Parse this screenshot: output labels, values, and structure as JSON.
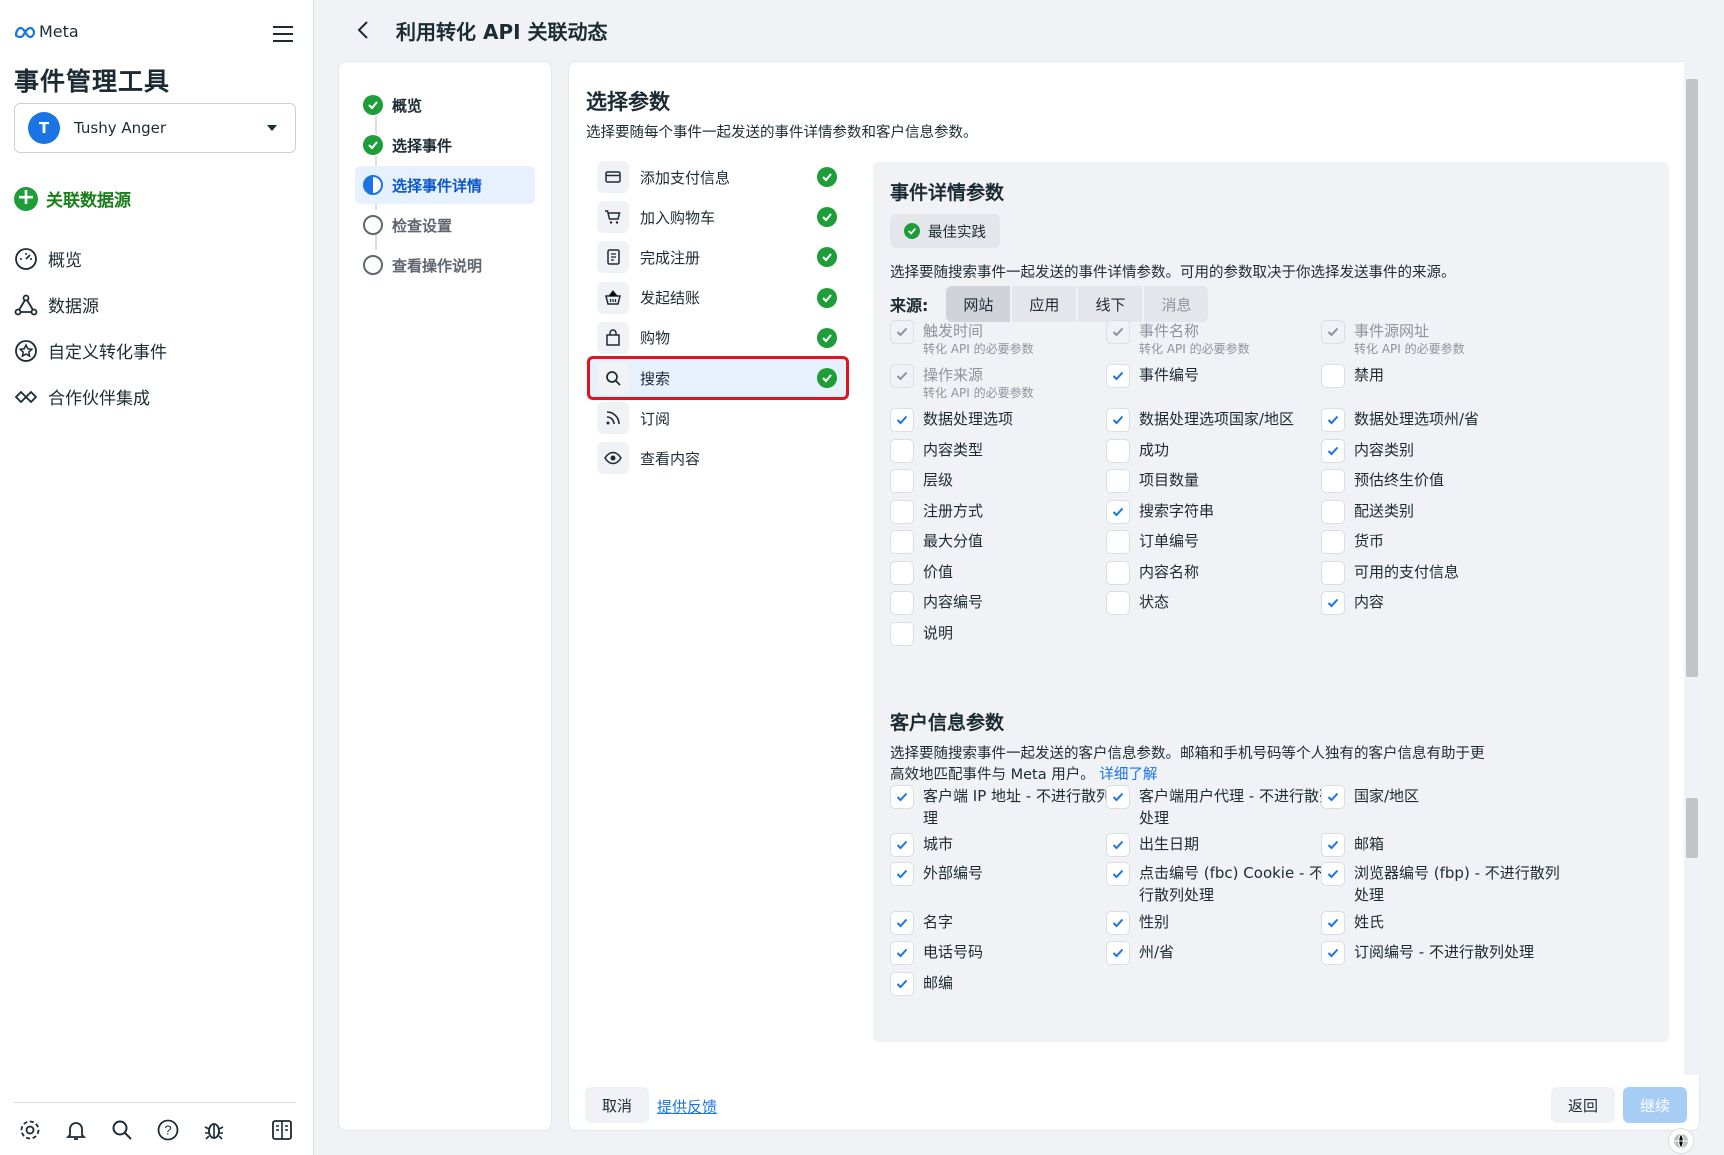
{
  "sidebar": {
    "brand": "Meta",
    "app_title": "事件管理工具",
    "account": {
      "initial": "T",
      "name": "Tushy Anger"
    },
    "connect_label": "关联数据源",
    "nav": [
      {
        "label": "概览",
        "icon": "dashboard-icon"
      },
      {
        "label": "数据源",
        "icon": "datasource-icon"
      },
      {
        "label": "自定义转化事件",
        "icon": "star-badge-icon"
      },
      {
        "label": "合作伙伴集成",
        "icon": "handshake-icon"
      }
    ],
    "bottom_icons": [
      "settings-icon",
      "bell-icon",
      "search-icon",
      "help-icon",
      "bug-icon",
      "panel-toggle-icon"
    ]
  },
  "header": {
    "title": "利用转化 API 关联动态"
  },
  "steps": [
    {
      "label": "概览",
      "state": "done"
    },
    {
      "label": "选择事件",
      "state": "done"
    },
    {
      "label": "选择事件详情",
      "state": "active"
    },
    {
      "label": "检查设置",
      "state": "pending"
    },
    {
      "label": "查看操作说明",
      "state": "pending"
    }
  ],
  "main": {
    "title": "选择参数",
    "subtitle": "选择要随每个事件一起发送的事件详情参数和客户信息参数。",
    "events": [
      {
        "label": "添加支付信息",
        "icon": "card-icon",
        "done": true
      },
      {
        "label": "加入购物车",
        "icon": "cart-icon",
        "done": true
      },
      {
        "label": "完成注册",
        "icon": "registration-icon",
        "done": true
      },
      {
        "label": "发起结账",
        "icon": "basket-icon",
        "done": true
      },
      {
        "label": "购物",
        "icon": "shopping-bag-icon",
        "done": true
      },
      {
        "label": "搜索",
        "icon": "search-icon",
        "done": true,
        "selected": true
      },
      {
        "label": "订阅",
        "icon": "rss-icon",
        "done": false
      },
      {
        "label": "查看内容",
        "icon": "eye-icon",
        "done": false
      }
    ]
  },
  "event_params": {
    "title": "事件详情参数",
    "badge": "最佳实践",
    "desc": "选择要随搜索事件一起发送的事件详情参数。可用的参数取决于你选择发送事件的来源。",
    "source_label": "来源:",
    "sources": [
      {
        "label": "网站",
        "state": "on"
      },
      {
        "label": "应用",
        "state": ""
      },
      {
        "label": "线下",
        "state": ""
      },
      {
        "label": "消息",
        "state": "dis"
      }
    ],
    "required_hint": "转化 API 的必要参数",
    "items": [
      {
        "label": "触发时间",
        "checked": true,
        "disabled": true,
        "hint": true
      },
      {
        "label": "事件名称",
        "checked": true,
        "disabled": true,
        "hint": true
      },
      {
        "label": "事件源网址",
        "checked": true,
        "disabled": true,
        "hint": true
      },
      {
        "label": "操作来源",
        "checked": true,
        "disabled": true,
        "hint": true
      },
      {
        "label": "事件编号",
        "checked": true
      },
      {
        "label": "禁用",
        "checked": false
      },
      {
        "label": "数据处理选项",
        "checked": true
      },
      {
        "label": "数据处理选项国家/地区",
        "checked": true
      },
      {
        "label": "数据处理选项州/省",
        "checked": true
      },
      {
        "label": "内容类型",
        "checked": false
      },
      {
        "label": "成功",
        "checked": false
      },
      {
        "label": "内容类别",
        "checked": true
      },
      {
        "label": "层级",
        "checked": false
      },
      {
        "label": "项目数量",
        "checked": false
      },
      {
        "label": "预估终生价值",
        "checked": false
      },
      {
        "label": "注册方式",
        "checked": false
      },
      {
        "label": "搜索字符串",
        "checked": true
      },
      {
        "label": "配送类别",
        "checked": false
      },
      {
        "label": "最大分值",
        "checked": false
      },
      {
        "label": "订单编号",
        "checked": false
      },
      {
        "label": "货币",
        "checked": false
      },
      {
        "label": "价值",
        "checked": false
      },
      {
        "label": "内容名称",
        "checked": false
      },
      {
        "label": "可用的支付信息",
        "checked": false
      },
      {
        "label": "内容编号",
        "checked": false
      },
      {
        "label": "状态",
        "checked": false
      },
      {
        "label": "内容",
        "checked": true
      },
      {
        "label": "说明",
        "checked": false
      }
    ]
  },
  "customer_params": {
    "title": "客户信息参数",
    "desc_line1": "选择要随搜索事件一起发送的客户信息参数。邮箱和手机号码等个人独有的客户信息有助于更",
    "desc_line2": "高效地匹配事件与 Meta 用户。",
    "learn_more": "详细了解",
    "items": [
      {
        "l1": "客户端 IP 地址 - 不进行散列处",
        "l2": "理",
        "checked": true
      },
      {
        "l1": "客户端用户代理 - 不进行散列",
        "l2": "处理",
        "checked": true
      },
      {
        "l1": "国家/地区",
        "l2": "",
        "checked": true
      },
      {
        "l1": "城市",
        "l2": "",
        "checked": true
      },
      {
        "l1": "出生日期",
        "l2": "",
        "checked": true
      },
      {
        "l1": "邮箱",
        "l2": "",
        "checked": true
      },
      {
        "l1": "外部编号",
        "l2": "",
        "checked": true
      },
      {
        "l1": "点击编号 (fbc) Cookie - 不进",
        "l2": "行散列处理",
        "checked": true
      },
      {
        "l1": "浏览器编号 (fbp) - 不进行散列",
        "l2": "处理",
        "checked": true
      },
      {
        "l1": "名字",
        "l2": "",
        "checked": true
      },
      {
        "l1": "性别",
        "l2": "",
        "checked": true
      },
      {
        "l1": "姓氏",
        "l2": "",
        "checked": true
      },
      {
        "l1": "电话号码",
        "l2": "",
        "checked": true
      },
      {
        "l1": "州/省",
        "l2": "",
        "checked": true
      },
      {
        "l1": "订阅编号 - 不进行散列处理",
        "l2": "",
        "checked": true
      },
      {
        "l1": "邮编",
        "l2": "",
        "checked": true
      }
    ]
  },
  "footer": {
    "cancel": "取消",
    "feedback": "提供反馈",
    "back": "返回",
    "continue": "继续"
  },
  "colors": {
    "accent": "#1b74e4",
    "success": "#1e9e38",
    "highlight_border": "#e0141e"
  }
}
